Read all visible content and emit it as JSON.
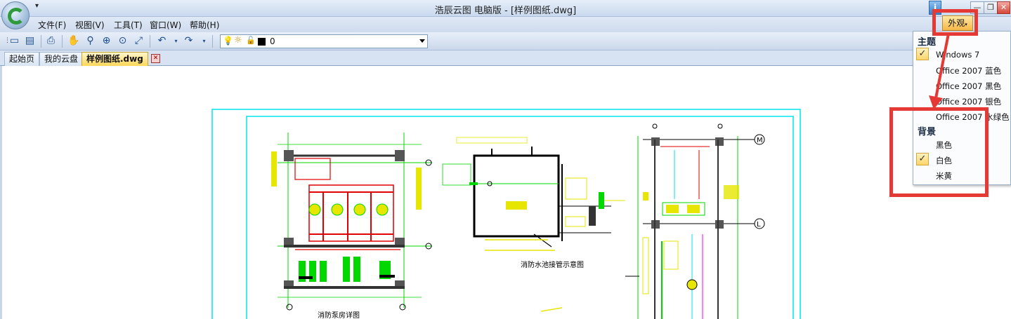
{
  "titlebar": {
    "title": "浩辰云图 电脑版 - [样例图纸.dwg]",
    "qat_label": "▾",
    "info_label": "i",
    "minimize": "—",
    "maximize": "❐",
    "close": "✕"
  },
  "menu": {
    "items": [
      "文件(F)",
      "视图(V)",
      "工具(T)",
      "窗口(W)",
      "帮助(H)"
    ]
  },
  "toolbar": {
    "layer_value": "0"
  },
  "tabs": {
    "items": [
      "起始页",
      "我的云盘",
      "样例图纸.dwg"
    ],
    "close_label": "✕"
  },
  "appearance": {
    "button_label": "外观",
    "caret": "▾",
    "mdi_min": "–",
    "mdi_restore": "❐",
    "mdi_close": "✕",
    "theme_heading": "主题",
    "themes": [
      "Windows 7",
      "Office 2007 蓝色",
      "Office 2007 黑色",
      "Office 2007 银色",
      "Office 2007 水绿色"
    ],
    "selected_theme": "Windows 7",
    "background_heading": "背景",
    "backgrounds": [
      "黑色",
      "白色",
      "米黄"
    ],
    "selected_background": "白色",
    "check_mark": "✓"
  },
  "drawing": {
    "labels": [
      "消防泵房详图",
      "消防水池接管示意图"
    ],
    "axis_markers": [
      "M",
      "L"
    ]
  },
  "colors": {
    "highlight": "#e53935",
    "cad_cyan": "#00e5ee",
    "cad_green": "#00d800",
    "cad_yellow": "#e6e600",
    "cad_red": "#e00000"
  }
}
